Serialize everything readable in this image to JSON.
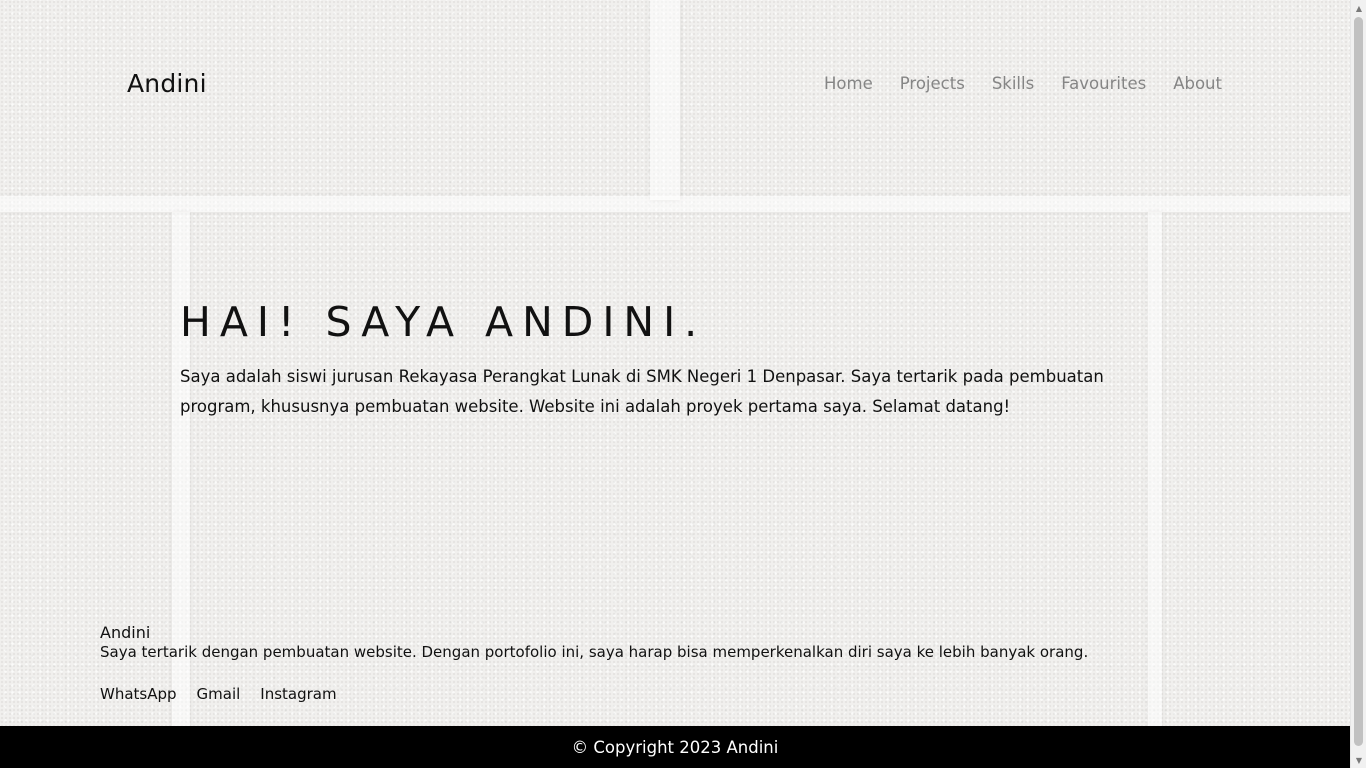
{
  "navbar": {
    "brand": "Andini",
    "links": [
      "Home",
      "Projects",
      "Skills",
      "Favourites",
      "About"
    ]
  },
  "hero": {
    "title": "HAI! SAYA ANDINI.",
    "description": "Saya adalah siswi jurusan Rekayasa Perangkat Lunak di SMK Negeri 1 Denpasar. Saya tertarik pada pembuatan program, khususnya pembuatan website. Website ini adalah proyek pertama saya. Selamat datang!"
  },
  "footer": {
    "title": "Andini",
    "description": "Saya tertarik dengan pembuatan website. Dengan portofolio ini, saya harap bisa memperkenalkan diri saya ke lebih banyak orang.",
    "links": [
      "WhatsApp",
      "Gmail",
      "Instagram"
    ]
  },
  "copyright": "© Copyright 2023 Andini",
  "colors": {
    "background": "#f1f0ee",
    "nav_link": "#858585",
    "text": "#111111",
    "copyright_bg": "#000000",
    "copyright_text": "#ffffff"
  },
  "icons": {
    "scroll_up": "scroll-up-arrow-icon",
    "scroll_down": "scroll-down-arrow-icon"
  }
}
